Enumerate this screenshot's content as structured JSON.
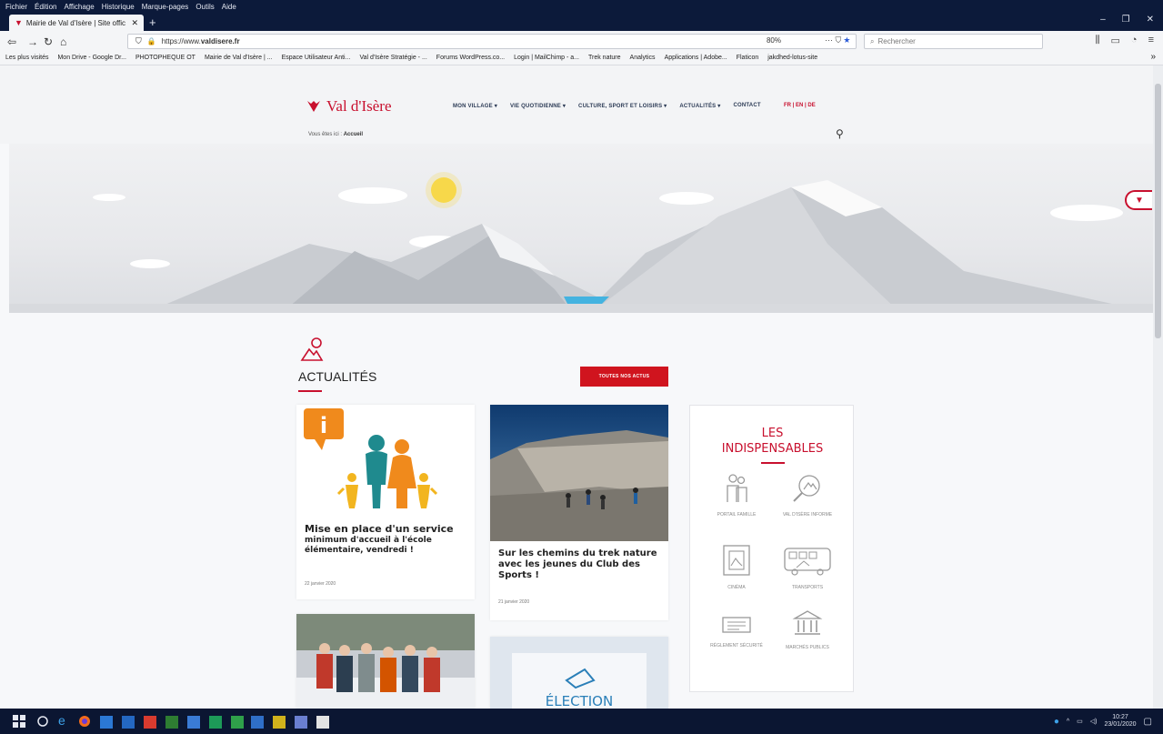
{
  "browser": {
    "menu": [
      "Fichier",
      "Édition",
      "Affichage",
      "Historique",
      "Marque-pages",
      "Outils",
      "Aide"
    ],
    "tab_title": "Mairie de Val d'Isère | Site offic",
    "url_prefix": "https://www.",
    "url_domain": "valdisere.fr",
    "zoom": "80%",
    "search_placeholder": "Rechercher",
    "bookmarks": [
      "Les plus visités",
      "Mon Drive - Google Dr...",
      "PHOTOPHEQUE OT",
      "Mairie de Val d'Isère | ...",
      "Espace Utilisateur Anti...",
      "Val d'Isère Stratégie - ...",
      "Forums WordPress.co...",
      "Login | MailChimp - a...",
      "Trek nature",
      "Analytics",
      "Applications | Adobe...",
      "Flaticon",
      "jakdhed-lotus-site"
    ]
  },
  "site": {
    "logo": "Val d'Isère",
    "nav": [
      "MON VILLAGE ▾",
      "VIE QUOTIDIENNE ▾",
      "CULTURE, SPORT ET LOISIRS ▾",
      "ACTUALITÉS ▾",
      "CONTACT"
    ],
    "languages": "FR | EN | DE",
    "breadcrumb_prefix": "Vous êtes ici :",
    "breadcrumb_current": "Accueil"
  },
  "news": {
    "title": "ACTUALITÉS",
    "all_button": "TOUTES NOS ACTUS",
    "cards": [
      {
        "title_1": "Mise en place d'un service",
        "title_2": "minimum d'accueil à l'école élémentaire, vendredi !",
        "date": "22 janvier 2020"
      },
      {
        "title": "Sur les chemins du trek nature avec les jeunes du Club des Sports !",
        "date": "21 janvier 2020"
      },
      {
        "badge": "ÉLECTION"
      }
    ]
  },
  "indispensables": {
    "title_1": "LES",
    "title_2": "INDISPENSABLES",
    "items": [
      "PORTAIL FAMILLE",
      "VAL D'ISÈRE INFORME",
      "CINÉMA",
      "TRANSPORTS",
      "RÈGLEMENT SÉCURITÉ",
      "MARCHÉS PUBLICS"
    ]
  },
  "taskbar": {
    "time": "10:27",
    "date": "23/01/2020"
  },
  "colors": {
    "brand": "#c8102e",
    "window": "#0c1a3a"
  }
}
